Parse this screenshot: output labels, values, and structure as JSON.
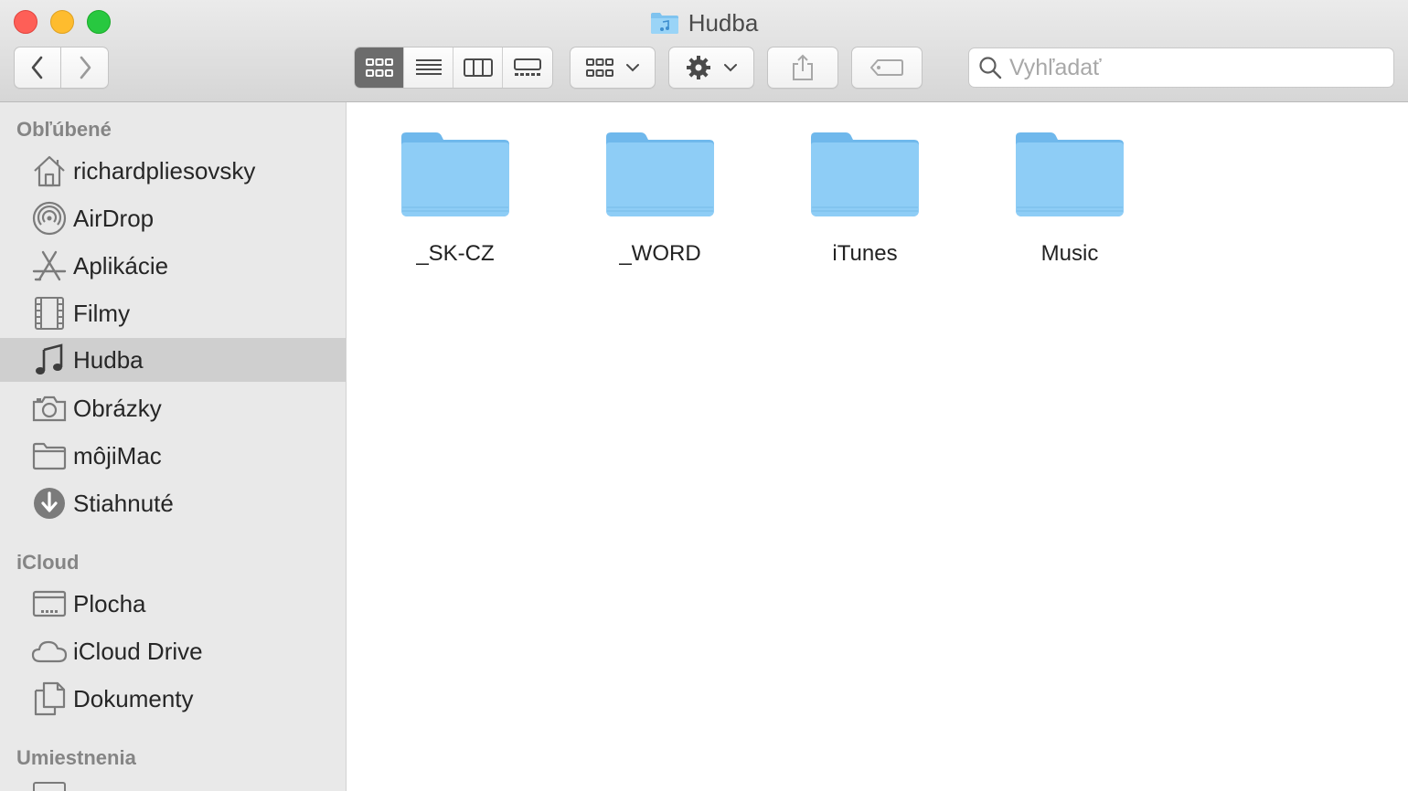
{
  "window": {
    "title": "Hudba"
  },
  "toolbar": {
    "back_icon": "chevron-left-icon",
    "forward_icon": "chevron-right-icon",
    "view_modes": [
      "icon-view",
      "list-view",
      "column-view",
      "gallery-view"
    ],
    "active_view": "icon-view",
    "group_icon": "group-by-icon",
    "action_icon": "gear-icon",
    "share_icon": "share-icon",
    "tag_icon": "tag-icon"
  },
  "search": {
    "placeholder": "Vyhľadať",
    "value": ""
  },
  "sidebar": {
    "sections": [
      {
        "title": "Obľúbené",
        "items": [
          {
            "label": "richardpliesovsky",
            "icon": "home-icon"
          },
          {
            "label": "AirDrop",
            "icon": "airdrop-icon"
          },
          {
            "label": "Aplikácie",
            "icon": "applications-icon"
          },
          {
            "label": "Filmy",
            "icon": "film-icon"
          },
          {
            "label": "Hudba",
            "icon": "music-note-icon",
            "selected": true
          },
          {
            "label": "Obrázky",
            "icon": "camera-icon"
          },
          {
            "label": "môjiMac",
            "icon": "folder-icon"
          },
          {
            "label": "Stiahnuté",
            "icon": "download-icon"
          }
        ]
      },
      {
        "title": "iCloud",
        "items": [
          {
            "label": "Plocha",
            "icon": "desktop-icon"
          },
          {
            "label": "iCloud Drive",
            "icon": "cloud-icon"
          },
          {
            "label": "Dokumenty",
            "icon": "documents-icon"
          }
        ]
      },
      {
        "title": "Umiestnenia",
        "items": []
      }
    ]
  },
  "files": [
    {
      "name": "_SK-CZ",
      "icon": "folder-icon"
    },
    {
      "name": "_WORD",
      "icon": "folder-icon"
    },
    {
      "name": "iTunes",
      "icon": "folder-icon"
    },
    {
      "name": "Music",
      "icon": "folder-icon"
    }
  ],
  "colors": {
    "folder_blue": "#8ecdf6",
    "selected_row": "#cfcfcf",
    "sidebar_bg": "#e9e9e9",
    "active_segment": "#6c6c6c"
  }
}
